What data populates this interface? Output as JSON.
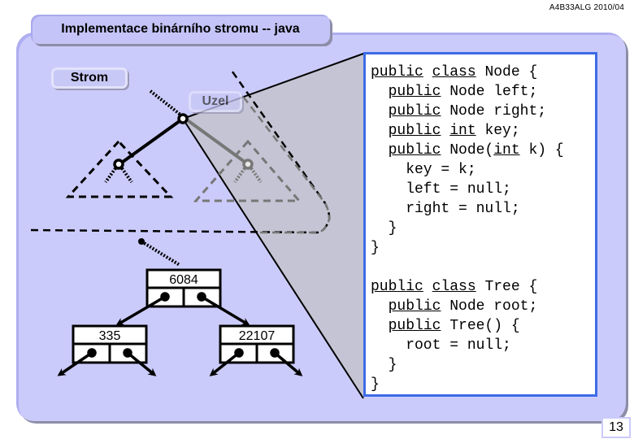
{
  "header": {
    "course_code": "A4B33ALG 2010/04",
    "title": "Implementace binárního stromu -- java"
  },
  "labels": {
    "tree": "Strom",
    "node": "Uzel"
  },
  "code": {
    "node_class": [
      [
        {
          "t": "public",
          "kw": true
        },
        {
          "t": " "
        },
        {
          "t": "class",
          "kw": true
        },
        {
          "t": " Node {"
        }
      ],
      [
        {
          "t": "  "
        },
        {
          "t": "public",
          "kw": true
        },
        {
          "t": " Node left;"
        }
      ],
      [
        {
          "t": "  "
        },
        {
          "t": "public",
          "kw": true
        },
        {
          "t": " Node right;"
        }
      ],
      [
        {
          "t": "  "
        },
        {
          "t": "public",
          "kw": true
        },
        {
          "t": " "
        },
        {
          "t": "int",
          "kw": true
        },
        {
          "t": " key;"
        }
      ],
      [
        {
          "t": "  "
        },
        {
          "t": "public",
          "kw": true
        },
        {
          "t": " Node("
        },
        {
          "t": "int",
          "kw": true
        },
        {
          "t": " k) {"
        }
      ],
      [
        {
          "t": "    key = k;"
        }
      ],
      [
        {
          "t": "    left = null;"
        }
      ],
      [
        {
          "t": "    right = null;"
        }
      ],
      [
        {
          "t": "  }"
        }
      ],
      [
        {
          "t": "}"
        }
      ]
    ],
    "tree_class": [
      [
        {
          "t": "public",
          "kw": true
        },
        {
          "t": " "
        },
        {
          "t": "class",
          "kw": true
        },
        {
          "t": " Tree {"
        }
      ],
      [
        {
          "t": "  "
        },
        {
          "t": "public",
          "kw": true
        },
        {
          "t": " Node root;"
        }
      ],
      [
        {
          "t": "  "
        },
        {
          "t": "public",
          "kw": true
        },
        {
          "t": " Tree() {"
        }
      ],
      [
        {
          "t": "    root = null;"
        }
      ],
      [
        {
          "t": "  }"
        }
      ],
      [
        {
          "t": "}"
        }
      ]
    ]
  },
  "tree_nodes": {
    "root": "6084",
    "left": "335",
    "right": "22107"
  },
  "footer": {
    "page_number": "13"
  },
  "colors": {
    "panel": "#cbcbfb",
    "code_border": "#3e6be6",
    "zoom_wedge": "#c4c4d4"
  }
}
